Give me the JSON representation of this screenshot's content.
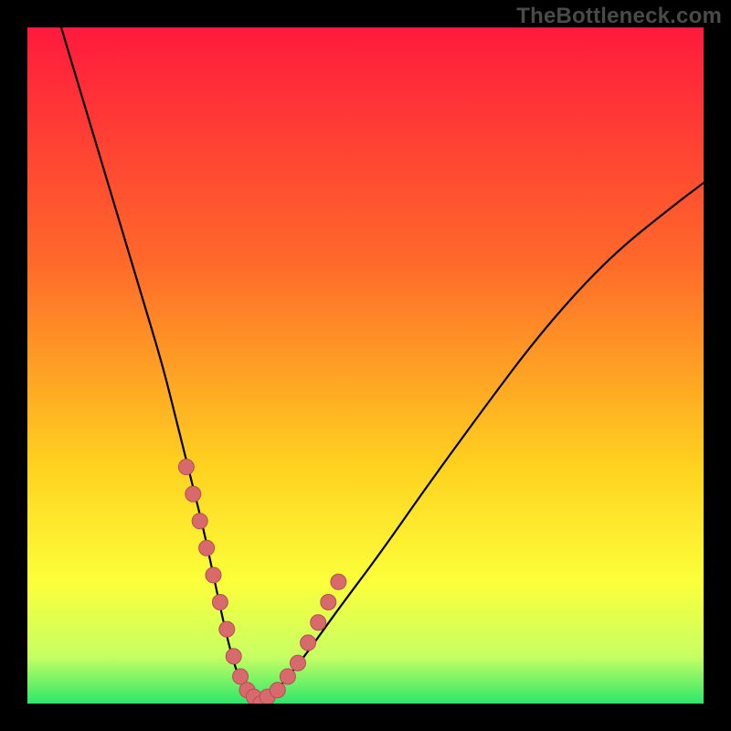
{
  "watermark": "TheBottleneck.com",
  "colors": {
    "frame_bg": "#000000",
    "gradient_top": "#ff1a3d",
    "gradient_mid1": "#ff6a2a",
    "gradient_mid2": "#ffd21f",
    "gradient_mid3": "#fcff3a",
    "gradient_mid4": "#c7ff63",
    "gradient_bottom": "#2ee66a",
    "curve": "#000000",
    "dot_fill": "#d86a6d",
    "dot_stroke": "#b34f52"
  },
  "chart_data": {
    "type": "line",
    "title": "",
    "xlabel": "",
    "ylabel": "",
    "xlim": [
      0,
      100
    ],
    "ylim": [
      0,
      100
    ],
    "series": [
      {
        "name": "bottleneck-curve",
        "x": [
          5,
          8,
          11,
          14,
          17,
          20,
          22,
          24,
          26,
          27.5,
          29,
          30.5,
          32,
          34,
          37,
          41,
          46,
          52,
          59,
          67,
          76,
          86,
          96,
          100
        ],
        "values": [
          100,
          90,
          80,
          70,
          60,
          50,
          42,
          34,
          26,
          19,
          12,
          6,
          2,
          0,
          2,
          7,
          14,
          22,
          32,
          43,
          55,
          66,
          74,
          77
        ]
      }
    ],
    "highlight_points": {
      "name": "data-dots",
      "x": [
        23.5,
        24.5,
        25.5,
        26.5,
        27.5,
        28.5,
        29.5,
        30.5,
        31.5,
        32.5,
        33.5,
        34.5,
        35.5,
        37.0,
        38.5,
        40.0,
        41.5,
        43.0,
        44.5,
        46.0
      ],
      "values": [
        35,
        31,
        27,
        23,
        19,
        15,
        11,
        7,
        4,
        2,
        1,
        0,
        1,
        2,
        4,
        6,
        9,
        12,
        15,
        18
      ]
    }
  }
}
